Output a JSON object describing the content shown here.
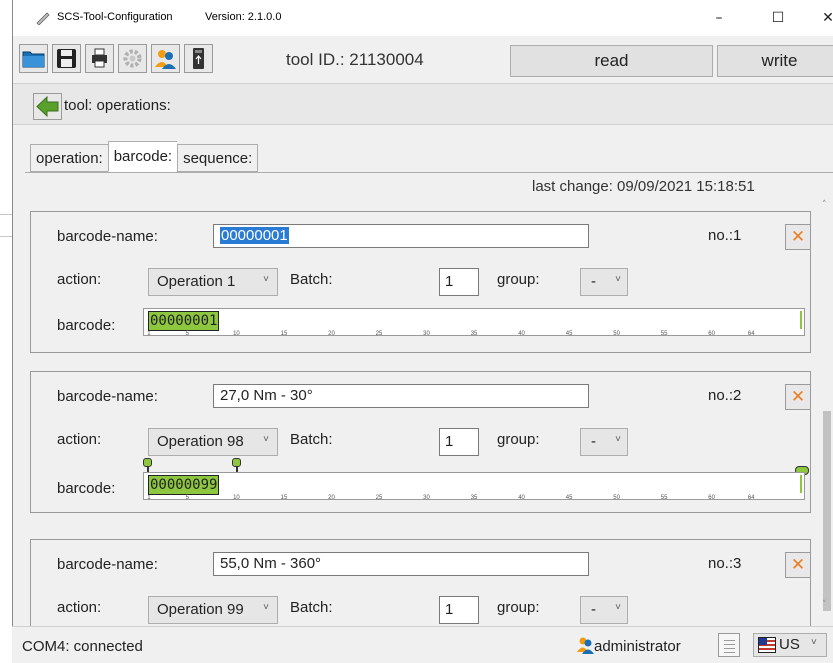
{
  "window": {
    "title": "SCS-Tool-Configuration",
    "version": "Version: 2.1.0.0",
    "minimize": "–",
    "maximize": "☐",
    "close": "✕"
  },
  "toolbar": {
    "icons": [
      "folder-icon",
      "save-icon",
      "printer-icon",
      "gear-icon",
      "users-icon",
      "usb-icon"
    ],
    "tool_id": "tool ID.: 21130004",
    "read_label": "read",
    "write_label": "write"
  },
  "nav": {
    "title": "tool: operations:"
  },
  "tabs": [
    {
      "label": "operation:",
      "active": false
    },
    {
      "label": "barcode:",
      "active": true
    },
    {
      "label": "sequence:",
      "active": false
    }
  ],
  "last_change": "last change:  09/09/2021  15:18:51",
  "labels": {
    "barcode_name": "barcode-name:",
    "action": "action:",
    "batch": "Batch:",
    "group": "group:",
    "barcode": "barcode:"
  },
  "ruler_ticks": [
    "1",
    "5",
    "10",
    "15",
    "20",
    "25",
    "30",
    "35",
    "40",
    "45",
    "50",
    "55",
    "60",
    "64"
  ],
  "barcodes": [
    {
      "name": "00000001",
      "no": "no.:1",
      "action": "Operation 1",
      "batch": "1",
      "group": "-",
      "barcode": "00000001",
      "name_selected": true
    },
    {
      "name": "27,0 Nm - 30°",
      "no": "no.:2",
      "action": "Operation 98",
      "batch": "1",
      "group": "-",
      "barcode": "00000099",
      "name_selected": false
    },
    {
      "name": "55,0 Nm - 360°",
      "no": "no.:3",
      "action": "Operation 99",
      "batch": "1",
      "group": "-",
      "barcode": "",
      "name_selected": false
    }
  ],
  "status": {
    "connection": "COM4: connected",
    "user": "administrator",
    "language": "US"
  },
  "colors": {
    "barcode_highlight": "#8dc63f",
    "selection": "#2a7bd3",
    "delete_x": "#e67e22"
  }
}
